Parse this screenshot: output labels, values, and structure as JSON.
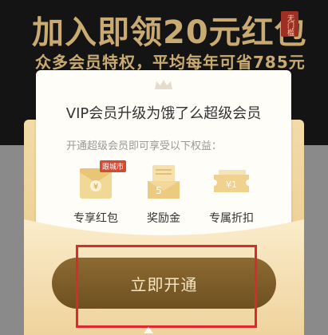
{
  "banner": {
    "title": "加入即领20元红包",
    "badge": "无门槛",
    "subtitle": "众多会员特权，平均每年可省785元"
  },
  "card": {
    "title": "VIP会员升级为饿了么超级会员",
    "description": "开通超级会员即可享受以下权益：",
    "benefits": [
      {
        "label": "专享红包",
        "icon": "red-envelope-icon",
        "tag": "跟城市"
      },
      {
        "label": "奖励金",
        "icon": "reward-cash-icon",
        "glyph": "5"
      },
      {
        "label": "专属折扣",
        "icon": "discount-coupon-icon",
        "glyph": "¥1"
      }
    ]
  },
  "cta": {
    "label": "立即开通"
  },
  "colors": {
    "gold": "#c9ab72",
    "button": "#7d5e28",
    "highlight": "#e0272e",
    "badge": "#9e2f23"
  }
}
